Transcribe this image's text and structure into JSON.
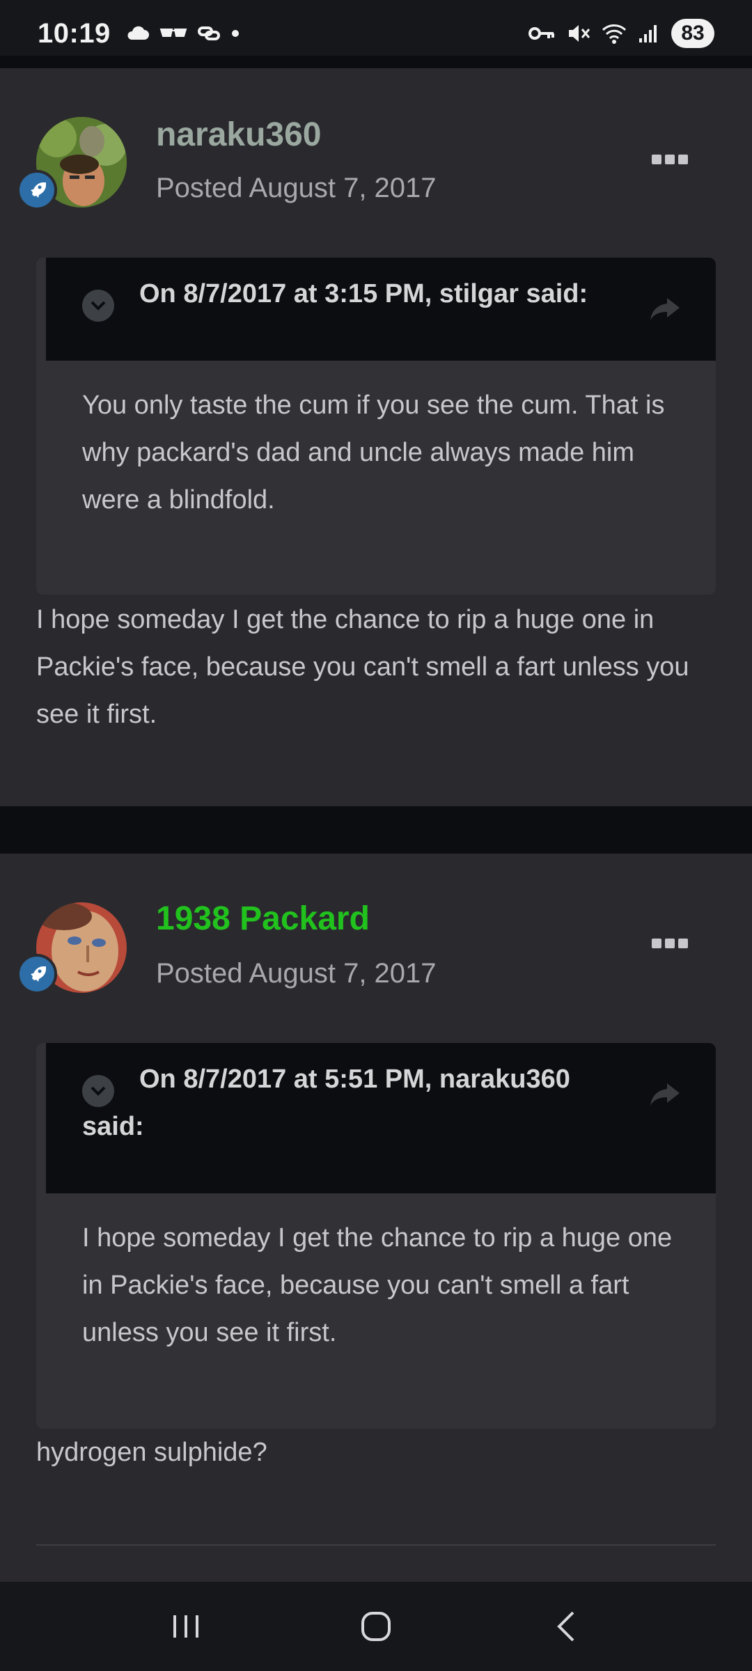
{
  "status_bar": {
    "time": "10:19",
    "battery": "83",
    "left_icons": [
      "cloud-icon",
      "glasses-icon",
      "link-icon",
      "dot-icon"
    ],
    "right_icons": [
      "key-icon",
      "mute-icon",
      "wifi-icon",
      "signal-icon"
    ]
  },
  "posts": [
    {
      "author": "naraku360",
      "author_color": "#9aa8a0",
      "posted": "Posted August 7, 2017",
      "quote_header": "On 8/7/2017 at 3:15 PM, stilgar said:",
      "quote_body": "You only taste the cum if you see the cum. That is why packard's dad and uncle always made him were a blindfold.",
      "text": "I hope someday I get the chance to rip a huge one in Packie's face, because you can't smell a fart unless you see it first."
    },
    {
      "author": "1938 Packard",
      "author_color": "#22c21e",
      "posted": "Posted August 7, 2017",
      "quote_header": "On 8/7/2017 at 5:51 PM, naraku360 said:",
      "quote_body": "I hope someday I get the chance to rip a huge one in Packie's face, because you can't smell a fart unless you see it first.",
      "text": "hydrogen sulphide?"
    }
  ],
  "nav": {
    "icons": [
      "recent-apps-icon",
      "home-icon",
      "back-icon"
    ]
  }
}
